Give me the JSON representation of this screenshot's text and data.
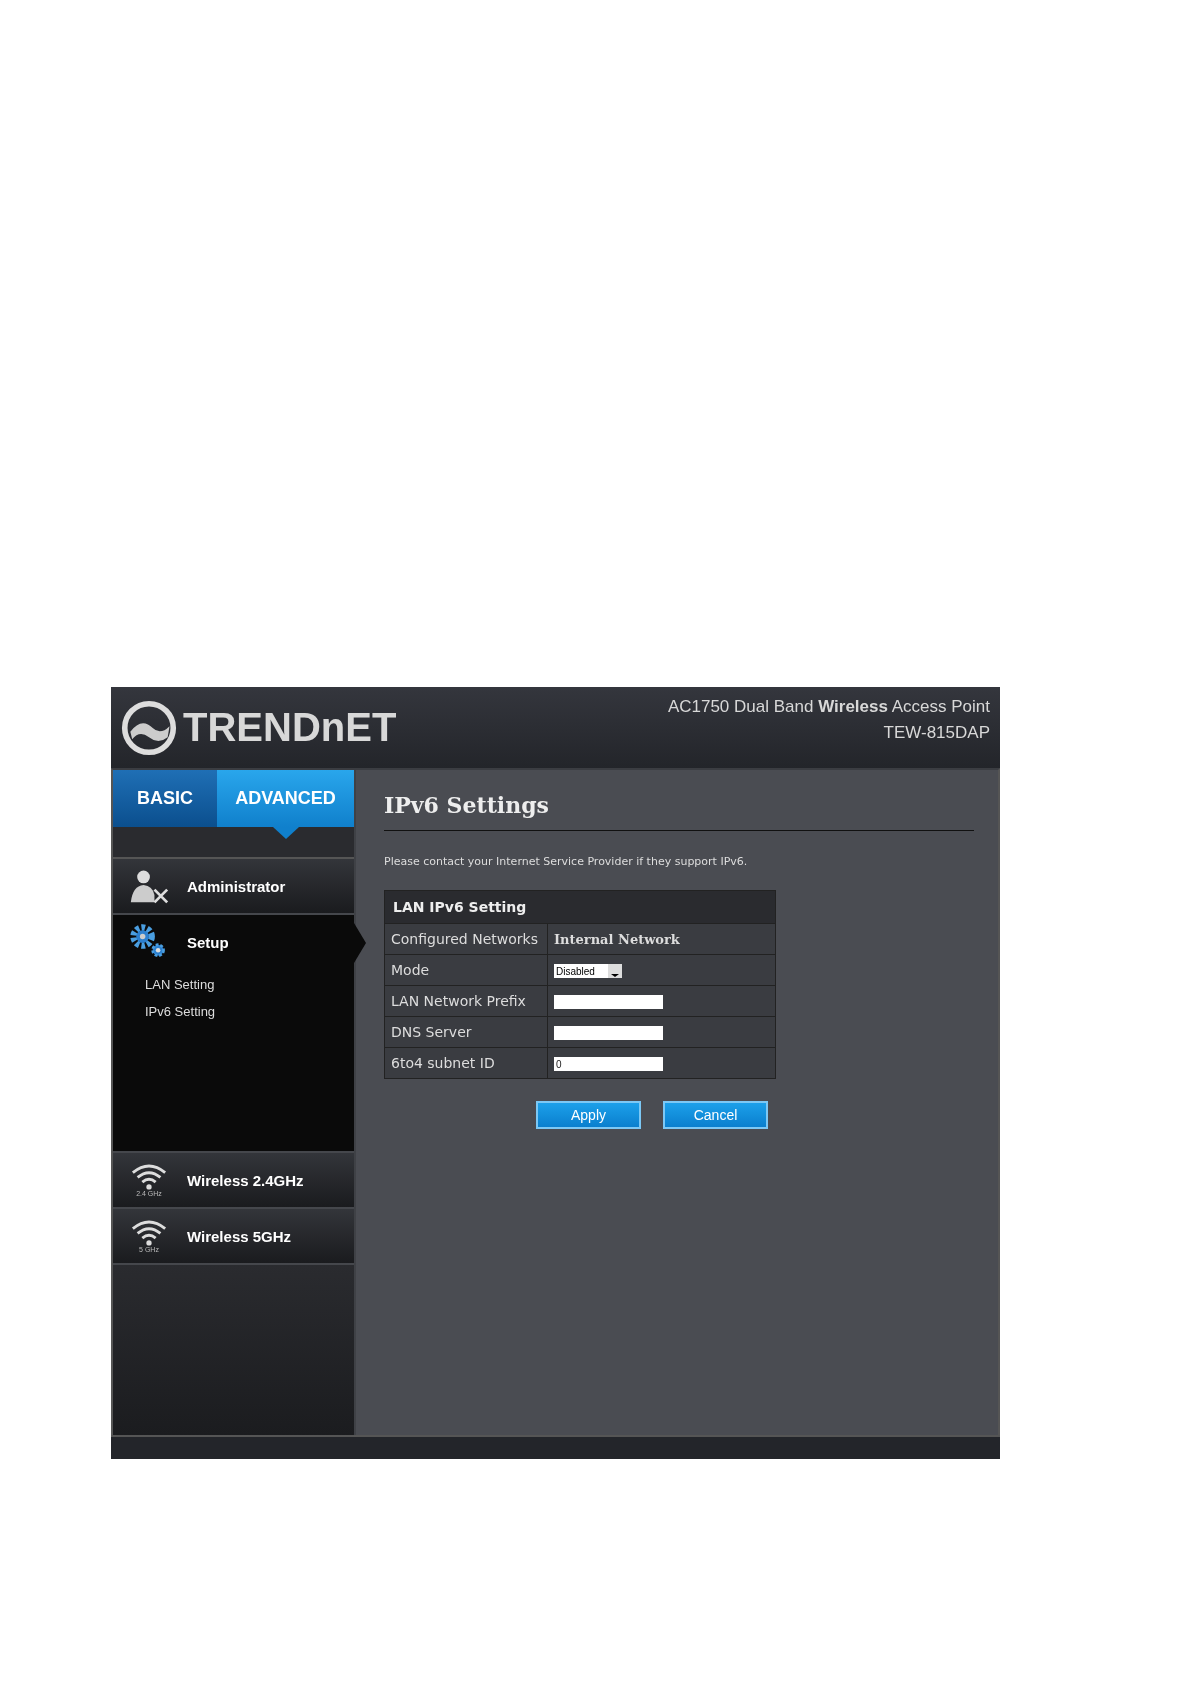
{
  "header": {
    "logo": "TRENDnET",
    "product": "AC1750 Dual Band **Wireless** Access Point",
    "model": "TEW-815DAP"
  },
  "tabs": [
    {
      "label": "BASIC",
      "selected": false
    },
    {
      "label": "ADVANCED",
      "selected": true
    }
  ],
  "sidebar": {
    "items": [
      {
        "label": "Administrator",
        "kind": "admin",
        "selected": false
      },
      {
        "label": "Setup",
        "kind": "gears",
        "selected": true,
        "expanded": true,
        "children": [
          {
            "label": "LAN Setting"
          },
          {
            "label": "IPv6 Setting"
          }
        ]
      },
      {
        "label": "Wireless 2.4GHz",
        "kind": "wifi",
        "icon_label": "2.4 GHz",
        "selected": false
      },
      {
        "label": "Wireless 5GHz",
        "kind": "wifi",
        "icon_label": "5 GHz",
        "selected": false
      }
    ]
  },
  "content": {
    "title": "IPv6 Settings",
    "note": "Please contact your Internet Service Provider if they support IPv6.",
    "table": {
      "title": "LAN IPv6 Setting",
      "rows": [
        {
          "label": "Configured Networks",
          "kind": "text",
          "value": "Internal Network"
        },
        {
          "label": "Mode",
          "kind": "select",
          "value": "Disabled"
        },
        {
          "label": "LAN Network Prefix",
          "kind": "input",
          "value": ""
        },
        {
          "label": "DNS Server",
          "kind": "input",
          "value": ""
        },
        {
          "label": "6to4 subnet ID",
          "kind": "input",
          "value": "0"
        }
      ]
    },
    "buttons": [
      "Apply",
      "Cancel"
    ]
  }
}
